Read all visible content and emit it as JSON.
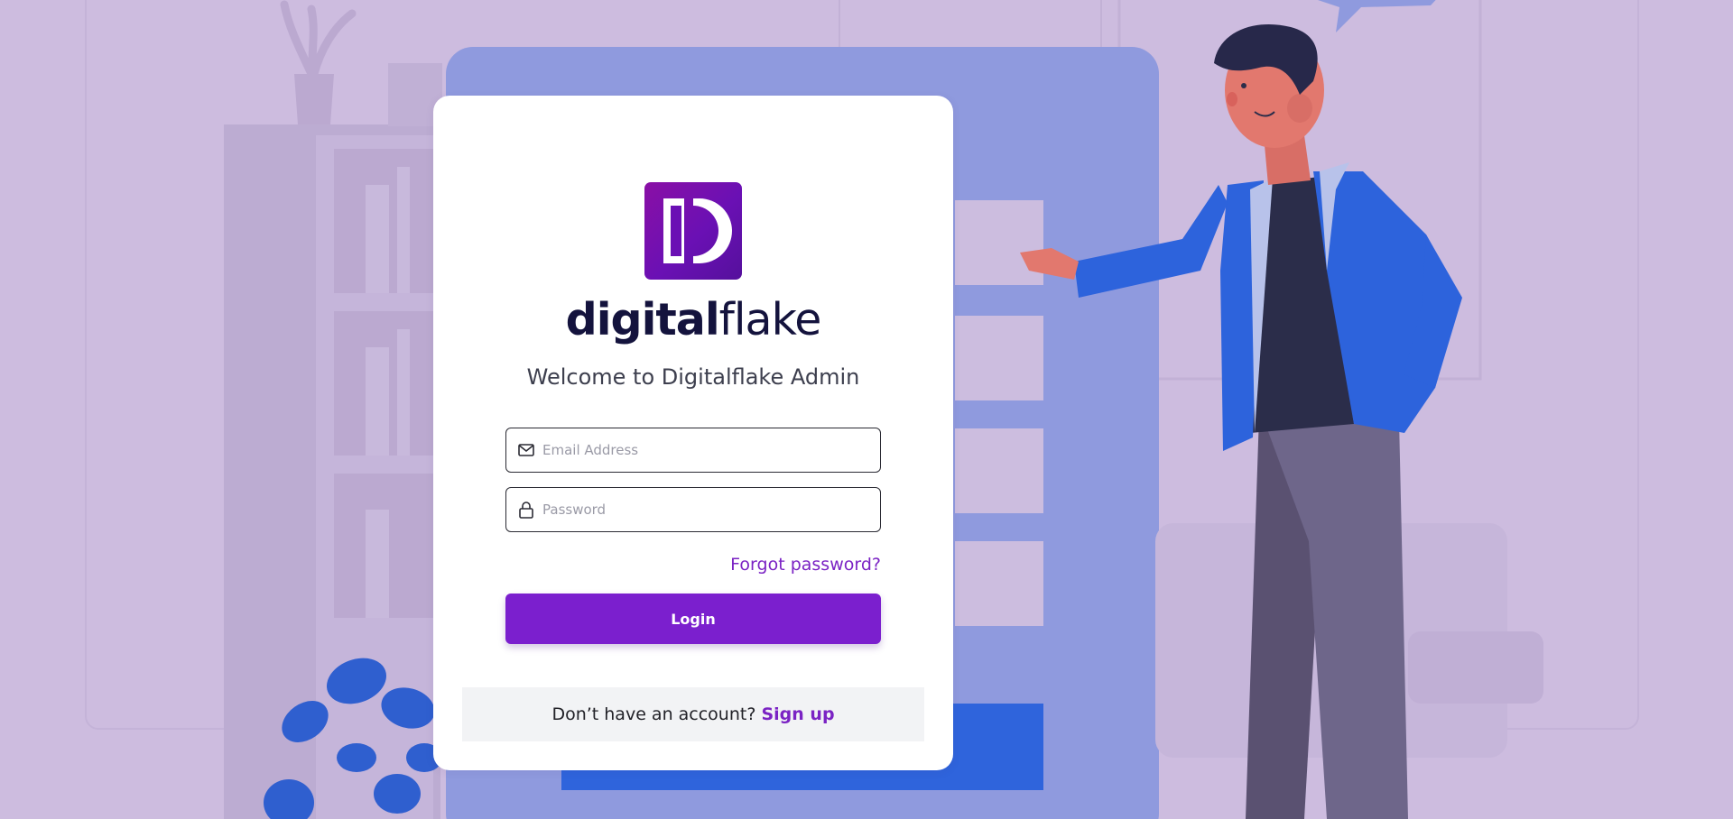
{
  "brand": {
    "name_bold": "digital",
    "name_light": "flake",
    "logo_icon": "digitalflake-d-logo-icon",
    "primary_color": "#7b1fce",
    "text_color": "#14133d"
  },
  "welcome_text": "Welcome to Digitalflake Admin",
  "form": {
    "email": {
      "placeholder": "Email Address",
      "value": "",
      "icon": "mail-icon"
    },
    "password": {
      "placeholder": "Password",
      "value": "",
      "icon": "lock-icon"
    },
    "forgot_label": "Forgot password?",
    "login_label": "Login"
  },
  "signup": {
    "prompt": "Don’t have an account?",
    "link_label": "Sign up"
  },
  "background": {
    "color": "#cdbcdf",
    "illustration": "man-presenting-login-screen-illustration"
  }
}
